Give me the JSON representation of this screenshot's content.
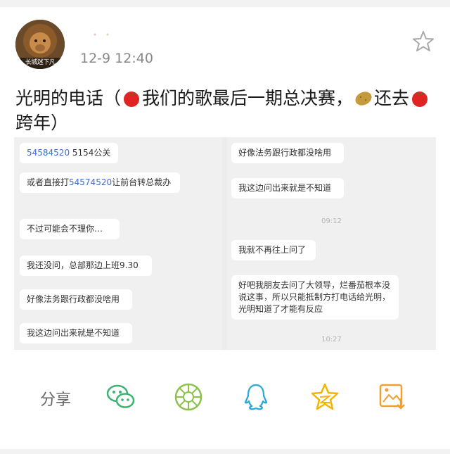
{
  "post": {
    "time": "12-9 12:40",
    "avatar_caption": "长城迷下凡",
    "text_part1": "光明的电话（",
    "text_part2": "我们的歌最后一期总决赛，",
    "text_part3": "还去",
    "text_part4": "跨年）",
    "icons": [
      "tomato-emoji",
      "potato-emoji"
    ]
  },
  "screenshot": {
    "left_messages": [
      {
        "link": "54584520",
        "text": " 5154公关"
      },
      {
        "pre": "或者直接打",
        "link": "54574520",
        "text": "让前台转总裁办"
      },
      {
        "text": "不过可能会不理你…"
      },
      {
        "text": "我还没问，总部那边上班9.30"
      },
      {
        "text": "好像法务跟行政都没啥用"
      },
      {
        "text": "我这边问出来就是不知道"
      }
    ],
    "right_messages": [
      {
        "text": "好像法务跟行政都没啥用"
      },
      {
        "text": "我这边问出来就是不知道"
      },
      {
        "text": "我就不再往上问了"
      },
      {
        "text": "好吧我朋友去问了大领导，烂番茄根本没说这事，所以只能抵制方打电话给光明，光明知道了才能有反应"
      }
    ],
    "timestamps": [
      "09:12",
      "10:27"
    ]
  },
  "actions": {
    "share_label": "分享",
    "icons": [
      "wechat-icon",
      "moments-icon",
      "qq-icon",
      "qzone-icon",
      "save-image-icon"
    ]
  },
  "colors": {
    "accent": "#3cb371",
    "moments": "#8bc34a",
    "qq": "#2aa8d8",
    "qzone": "#f5b400",
    "save": "#f0a030",
    "link": "#3b6fc4"
  }
}
